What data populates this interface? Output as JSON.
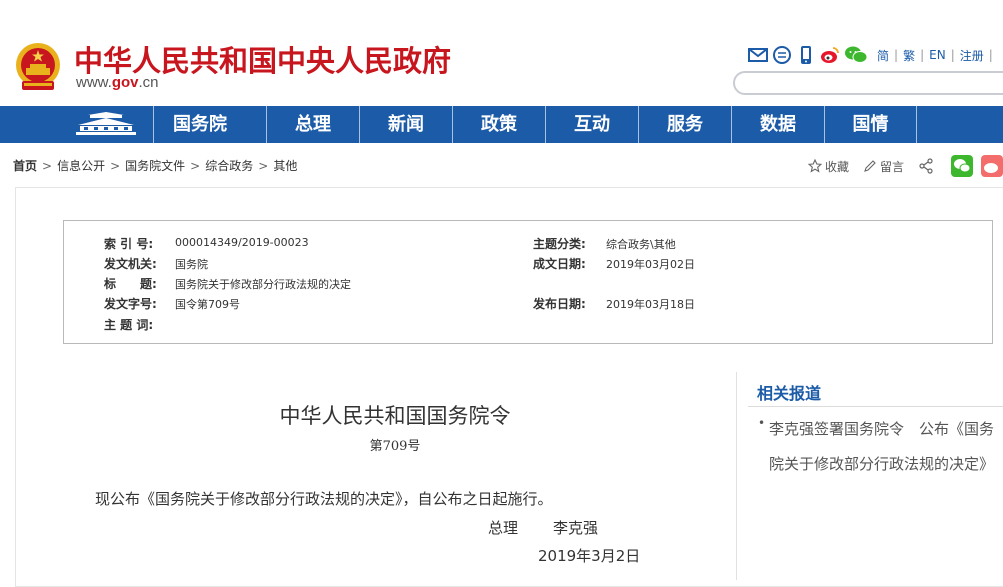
{
  "header": {
    "site_title": "中华人民共和国中央人民政府",
    "url_prefix": "www.",
    "url_gov": "gov",
    "url_suffix": ".cn",
    "lang_links": [
      "简",
      "繁",
      "EN",
      "注册"
    ],
    "tool_icons": [
      "mail-icon",
      "chat-icon",
      "mobile-icon",
      "weibo-icon",
      "wechat-icon"
    ],
    "search_placeholder": ""
  },
  "nav": {
    "items": [
      "国务院",
      "总理",
      "新闻",
      "政策",
      "互动",
      "服务",
      "数据",
      "国情"
    ]
  },
  "breadcrumb": {
    "items": [
      "首页",
      "信息公开",
      "国务院文件",
      "综合政务",
      "其他"
    ]
  },
  "page_actions": {
    "favorite_label": "收藏",
    "comment_label": "留言"
  },
  "info": {
    "index_label": "索 引 号:",
    "index_value": "000014349/2019-00023",
    "category_label": "主题分类:",
    "category_value": "综合政务\\其他",
    "issuer_label": "发文机关:",
    "issuer_value": "国务院",
    "created_label": "成文日期:",
    "created_value": "2019年03月02日",
    "title_label": "标　　题:",
    "title_value": "国务院关于修改部分行政法规的决定",
    "doc_no_label": "发文字号:",
    "doc_no_value": "国令第709号",
    "published_label": "发布日期:",
    "published_value": "2019年03月18日",
    "keywords_label": "主 题 词:"
  },
  "document": {
    "title": "中华人民共和国国务院令",
    "number": "第709号",
    "body": "现公布《国务院关于修改部分行政法规的决定》，自公布之日起施行。",
    "signer_title": "总理",
    "signer_name": "李克强",
    "date": "2019年3月2日"
  },
  "sidebar": {
    "related_title": "相关报道",
    "related_items": [
      "李克强签署国务院令　公布《国务院关于修改部分行政法规的决定》"
    ]
  },
  "colors": {
    "brand_red": "#c8161e",
    "nav_blue": "#1c5ba8",
    "wechat_green": "#3db82e",
    "weibo_red": "#e6162d"
  }
}
